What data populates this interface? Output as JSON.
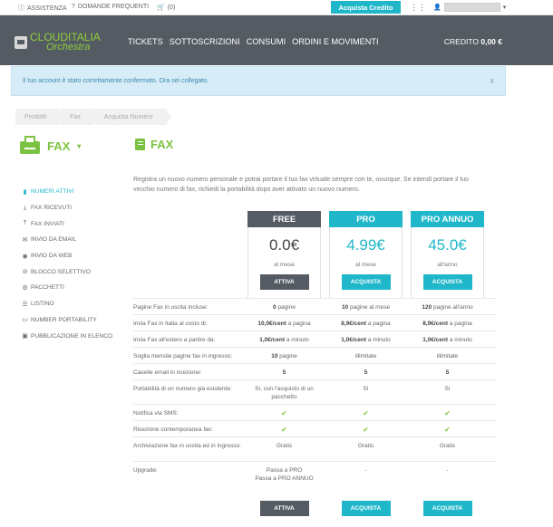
{
  "topbar": {
    "help": "ASSISTENZA",
    "faq": "DOMANDE FREQUENTI",
    "cart": "(0)",
    "buy_credit": "Acquista Credito"
  },
  "header": {
    "logo_line1": "CLOUDITALIA",
    "logo_line2": "Orchestra",
    "nav": [
      "TICKETS",
      "SOTTOSCRIZIONI",
      "CONSUMI",
      "ORDINI E MOVIMENTI"
    ],
    "credit_label": "CREDITO",
    "credit_value": "0,00 €"
  },
  "alert": {
    "message": "Il tuo account è stato correttamente confermato. Ora sei collegato.",
    "close": "x"
  },
  "breadcrumb": [
    "Prodotti",
    "Fax",
    "Acquista Numero"
  ],
  "side_title": "FAX",
  "main_title": "FAX",
  "sidebar": [
    {
      "label": "NUMERI ATTIVI",
      "icon": "book-icon",
      "active": true
    },
    {
      "label": "FAX RICEVUTI",
      "icon": "download-icon"
    },
    {
      "label": "FAX INVIATI",
      "icon": "upload-icon"
    },
    {
      "label": "INVIO DA EMAIL",
      "icon": "envelope-icon"
    },
    {
      "label": "INVIO DA WEB",
      "icon": "globe-icon"
    },
    {
      "label": "BLOCCO SELETTIVO",
      "icon": "block-icon"
    },
    {
      "label": "PACCHETTI",
      "icon": "gear-icon"
    },
    {
      "label": "LISTINO",
      "icon": "list-icon"
    },
    {
      "label": "NUMBER PORTABILITY",
      "icon": "card-icon"
    },
    {
      "label": "PUBBLICAZIONE IN ELENCO",
      "icon": "publish-icon"
    }
  ],
  "intro": "Registra un nuovo numero personale e potrai portare il tuo fax virtuale sempre con te, ovunque. Se intendi portare il tuo vecchio numero di fax, richiedi la portabilità dopo aver attivato un nuovo numero.",
  "plans": [
    {
      "name": "FREE",
      "price": "0.0€",
      "period": "al mese",
      "button": "ATTIVA",
      "color": "#555b63"
    },
    {
      "name": "PRO",
      "price": "4.99€",
      "period": "al mese",
      "button": "ACQUISTA",
      "color": "#1fb7c9"
    },
    {
      "name": "PRO ANNUO",
      "price": "45.0€",
      "period": "all'anno",
      "button": "ACQUISTA",
      "color": "#1fb7c9"
    }
  ],
  "rows": [
    {
      "label": "Pagine Fax in uscita incluse:",
      "v": [
        [
          "0",
          " pagine"
        ],
        [
          "10",
          " pagine al mese"
        ],
        [
          "120",
          " pagine all'anno"
        ]
      ]
    },
    {
      "label": "Invia Fax in Italia al costo di:",
      "v": [
        [
          "10,0€/cent",
          " a pagina"
        ],
        [
          "8,9€/cent",
          " a pagina"
        ],
        [
          "8,9€/cent",
          " a pagina"
        ]
      ]
    },
    {
      "label": "Invia Fax all'estero a partire da:",
      "v": [
        [
          "1,0€/cent",
          " a minuto"
        ],
        [
          "1,0€/cent",
          " a minuto"
        ],
        [
          "1,0€/cent",
          " a minuto"
        ]
      ]
    },
    {
      "label": "Soglia mensile pagine fax in ingresso:",
      "v": [
        [
          "10",
          " pagine"
        ],
        [
          "",
          "illimitate"
        ],
        [
          "",
          "illimitate"
        ]
      ]
    },
    {
      "label": "Caselle email in ricezione:",
      "v": [
        [
          "5",
          ""
        ],
        [
          "5",
          ""
        ],
        [
          "5",
          ""
        ]
      ]
    },
    {
      "label": "Portabilità di un numero già esistente:",
      "v": [
        [
          "",
          "Sì, con l'acquisto di un pacchetto"
        ],
        [
          "",
          "Sì"
        ],
        [
          "",
          "Sì"
        ]
      ]
    },
    {
      "label": "Notifica via SMS:",
      "check": true
    },
    {
      "label": "Ricezione contemporanea fax:",
      "check": true
    },
    {
      "label": "Archiviazione fax in uscita ed in ingresso:",
      "v": [
        [
          "",
          "Gratis"
        ],
        [
          "",
          "Gratis"
        ],
        [
          "",
          "Gratis"
        ]
      ]
    },
    {
      "label": "Upgrade:",
      "v": [
        [
          "",
          "Passa a PRO\nPassa a PRO ANNUO"
        ],
        [
          "",
          "-"
        ],
        [
          "",
          "-"
        ]
      ]
    }
  ],
  "colors": {
    "accent": "#1fb7c9",
    "brand_green": "#7cc242",
    "header_bg": "#555b63"
  }
}
